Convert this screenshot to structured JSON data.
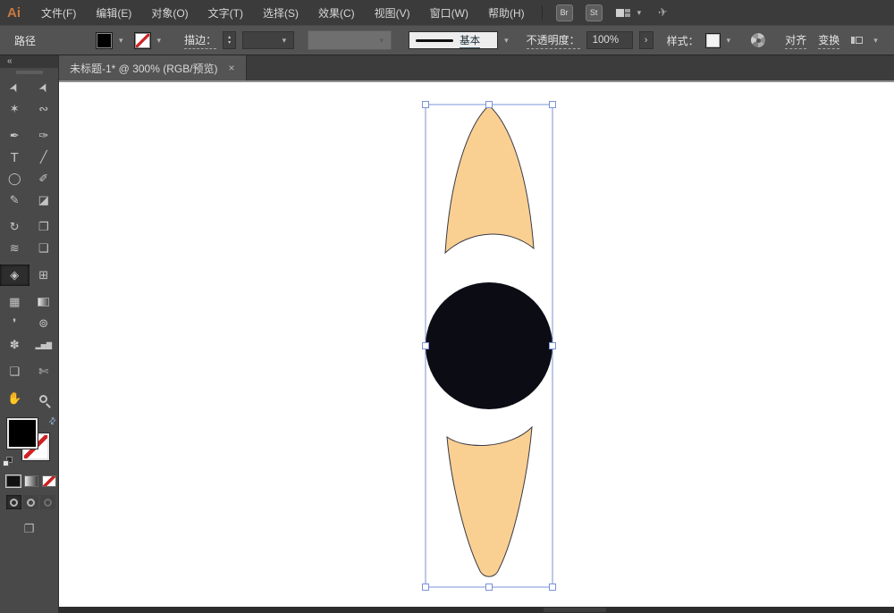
{
  "app": {
    "logo": "Ai"
  },
  "icons": {
    "chevron_down": "▾",
    "up": "▴",
    "down": "▾",
    "collapse": "«",
    "close": "×",
    "swap": "⇄",
    "panel_arrow": "›",
    "plane": "✈"
  },
  "menubar": {
    "items": [
      "文件(F)",
      "编辑(E)",
      "对象(O)",
      "文字(T)",
      "选择(S)",
      "效果(C)",
      "视图(V)",
      "窗口(W)",
      "帮助(H)"
    ],
    "bridge_label": "Br",
    "stock_label": "St"
  },
  "controlbar": {
    "selection_label": "路径",
    "stroke_label": "描边：",
    "brush_style_label": "基本",
    "opacity_label": "不透明度：",
    "opacity_value": "100%",
    "style_label": "样式：",
    "align_label": "对齐",
    "transform_label": "变换"
  },
  "tabbar": {
    "document_tab": "未标题-1* @ 300% (RGB/预览)"
  },
  "toolbar": {
    "tools": [
      {
        "name": "selection-tool",
        "glyph": "➤"
      },
      {
        "name": "direct-selection-tool",
        "glyph": "➤"
      },
      {
        "name": "magic-wand-tool",
        "glyph": "✶"
      },
      {
        "name": "lasso-tool",
        "glyph": "∾"
      },
      {
        "name": "pen-tool",
        "glyph": "✒"
      },
      {
        "name": "curvature-tool",
        "glyph": "✑"
      },
      {
        "name": "type-tool",
        "glyph": "T"
      },
      {
        "name": "line-segment-tool",
        "glyph": "╱"
      },
      {
        "name": "ellipse-tool",
        "glyph": "◯"
      },
      {
        "name": "paintbrush-tool",
        "glyph": "✐"
      },
      {
        "name": "pencil-tool",
        "glyph": "✎"
      },
      {
        "name": "eraser-tool",
        "glyph": "◪"
      },
      {
        "name": "rotate-tool",
        "glyph": "↻"
      },
      {
        "name": "scale-tool",
        "glyph": "❐"
      },
      {
        "name": "width-tool",
        "glyph": "≋"
      },
      {
        "name": "free-transform-tool",
        "glyph": "❑"
      },
      {
        "name": "shape-builder-tool",
        "glyph": "◈"
      },
      {
        "name": "perspective-grid-tool",
        "glyph": "⊞"
      },
      {
        "name": "mesh-tool",
        "glyph": "▦"
      },
      {
        "name": "gradient-tool",
        "glyph": ""
      },
      {
        "name": "eyedropper-tool",
        "glyph": "❜"
      },
      {
        "name": "blend-tool",
        "glyph": "⊚"
      },
      {
        "name": "symbol-sprayer-tool",
        "glyph": "✽"
      },
      {
        "name": "column-graph-tool",
        "glyph": "▂▅▇"
      },
      {
        "name": "artboard-tool",
        "glyph": "❏"
      },
      {
        "name": "slice-tool",
        "glyph": "✄"
      },
      {
        "name": "hand-tool",
        "glyph": "✋"
      },
      {
        "name": "zoom-tool",
        "glyph": ""
      }
    ]
  },
  "canvas": {
    "selection": {
      "box_stroke": "#7b93d6",
      "handle_fill": "#ffffff",
      "handle_stroke": "#7b93d6"
    },
    "shapes": {
      "petal_fill": "#fad092",
      "petal_stroke": "#3a3a45",
      "circle_fill": "#0c0c15"
    }
  }
}
